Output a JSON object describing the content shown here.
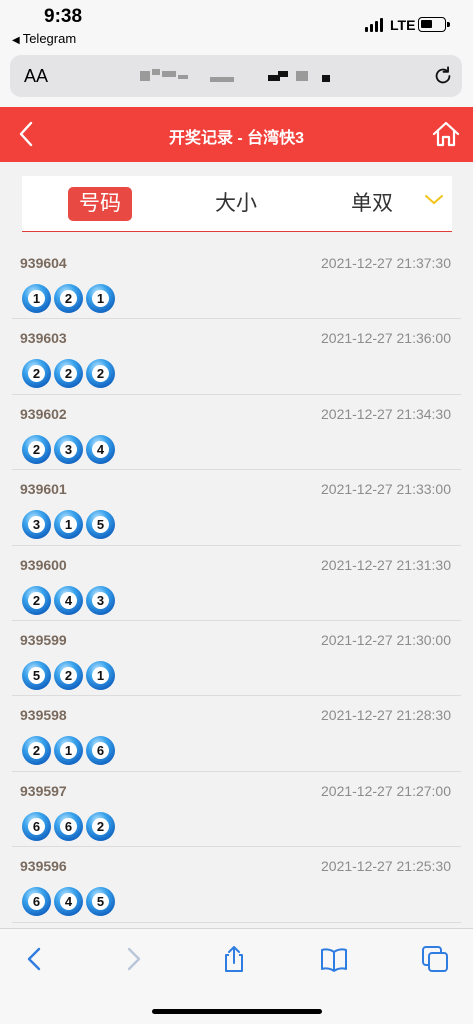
{
  "status": {
    "time": "9:38",
    "back_app": "Telegram",
    "network": "LTE"
  },
  "browser": {
    "aa_label": "AA"
  },
  "header": {
    "title": "开奖记录 - 台湾快3"
  },
  "tabs": [
    {
      "label": "号码",
      "active": true
    },
    {
      "label": "大小",
      "active": false
    },
    {
      "label": "单双",
      "active": false
    }
  ],
  "results": [
    {
      "issue": "939604",
      "datetime": "2021-12-27 21:37:30",
      "balls": [
        "1",
        "2",
        "1"
      ]
    },
    {
      "issue": "939603",
      "datetime": "2021-12-27 21:36:00",
      "balls": [
        "2",
        "2",
        "2"
      ]
    },
    {
      "issue": "939602",
      "datetime": "2021-12-27 21:34:30",
      "balls": [
        "2",
        "3",
        "4"
      ]
    },
    {
      "issue": "939601",
      "datetime": "2021-12-27 21:33:00",
      "balls": [
        "3",
        "1",
        "5"
      ]
    },
    {
      "issue": "939600",
      "datetime": "2021-12-27 21:31:30",
      "balls": [
        "2",
        "4",
        "3"
      ]
    },
    {
      "issue": "939599",
      "datetime": "2021-12-27 21:30:00",
      "balls": [
        "5",
        "2",
        "1"
      ]
    },
    {
      "issue": "939598",
      "datetime": "2021-12-27 21:28:30",
      "balls": [
        "2",
        "1",
        "6"
      ]
    },
    {
      "issue": "939597",
      "datetime": "2021-12-27 21:27:00",
      "balls": [
        "6",
        "6",
        "2"
      ]
    },
    {
      "issue": "939596",
      "datetime": "2021-12-27 21:25:30",
      "balls": [
        "6",
        "4",
        "5"
      ]
    }
  ],
  "toolbar": {
    "items": [
      "back-icon",
      "forward-icon",
      "share-icon",
      "bookmarks-icon",
      "tabs-icon"
    ]
  },
  "colors": {
    "header": "#f2413b",
    "active_tab": "#e84a43",
    "ball": "#1467c4"
  }
}
